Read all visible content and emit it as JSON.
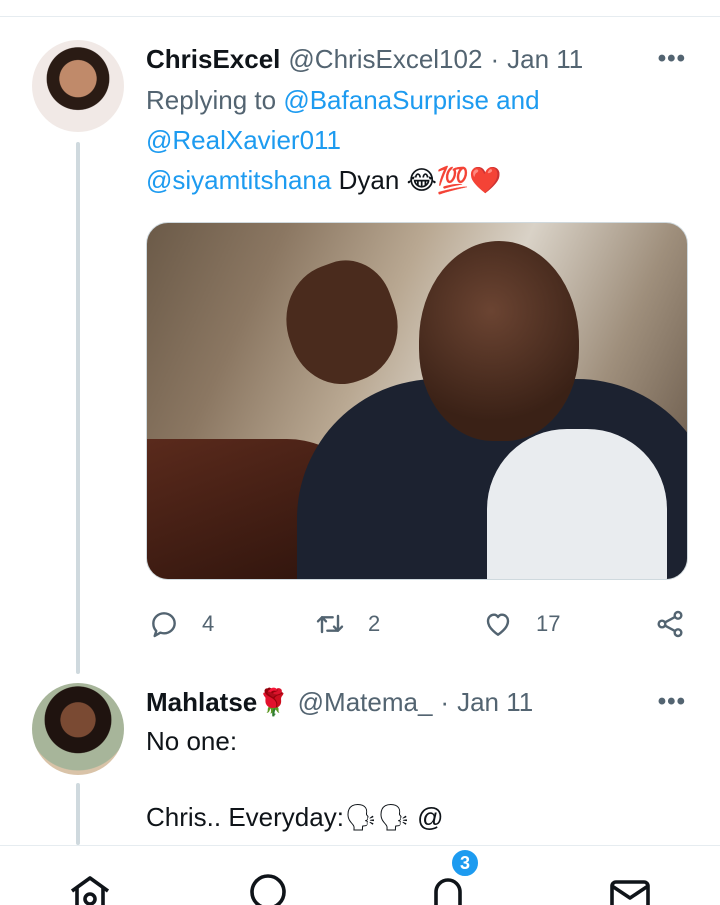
{
  "tweets": [
    {
      "name": "ChrisExcel",
      "handle": "@ChrisExcel102",
      "date": "Jan 11",
      "replying_prefix": "Replying to ",
      "replying_to_1": "@BafanaSurprise",
      "replying_join": " and",
      "replying_to_2": "@RealXavier011",
      "mention": "@siyamtitshana",
      "text": " Dyan 😂💯❤️",
      "replies": "4",
      "retweets": "2",
      "likes": "17"
    },
    {
      "name": "Mahlatse",
      "name_emoji": "🌹",
      "handle": "@Matema_",
      "date": "Jan 11",
      "line1": "No one:",
      "line3": "Chris.. Everyday:🗣🗣 @"
    }
  ],
  "icons": {
    "more": "more-dots-icon",
    "reply": "reply-icon",
    "retweet": "retweet-icon",
    "like": "heart-icon",
    "share": "share-icon",
    "home": "home-icon",
    "search": "search-icon",
    "notifications": "bell-icon",
    "messages": "mail-icon"
  },
  "nav": {
    "notification_count": "3"
  },
  "colors": {
    "link": "#1d9bf0",
    "secondary_text": "#536471",
    "thread_line": "#cfd9de"
  }
}
